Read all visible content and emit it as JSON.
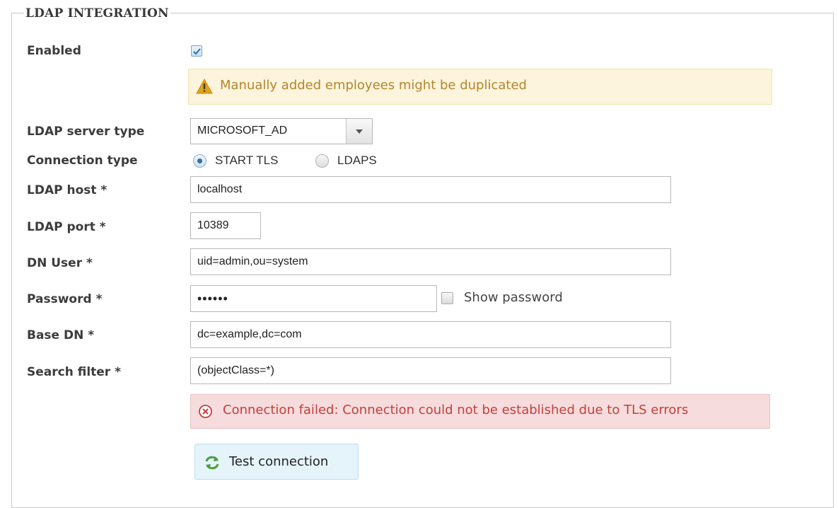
{
  "section": {
    "title": "LDAP INTEGRATION"
  },
  "fields": {
    "enabled_label": "Enabled",
    "enabled_checked": true,
    "server_type_label": "LDAP server type",
    "server_type_value": "MICROSOFT_AD",
    "connection_type_label": "Connection type",
    "connection_options": [
      {
        "label": "START TLS",
        "selected": true
      },
      {
        "label": "LDAPS",
        "selected": false
      }
    ],
    "host_label": "LDAP host *",
    "host_value": "localhost",
    "port_label": "LDAP port *",
    "port_value": "10389",
    "dn_user_label": "DN User *",
    "dn_user_value": "uid=admin,ou=system",
    "password_label": "Password *",
    "password_value": "••••••",
    "show_password_label": "Show password",
    "show_password_checked": false,
    "base_dn_label": "Base DN *",
    "base_dn_value": "dc=example,dc=com",
    "search_filter_label": "Search filter *",
    "search_filter_value": "(objectClass=*)"
  },
  "messages": {
    "warning": "Manually added employees might be duplicated",
    "error": "Connection failed: Connection could not be established due to TLS errors"
  },
  "actions": {
    "test_connection_label": "Test connection"
  },
  "icons": {
    "warning": "warning-triangle-icon",
    "error": "error-circle-x-icon",
    "refresh": "refresh-arrows-icon",
    "checkmark": "checkmark-icon",
    "dropdown": "chevron-down-icon"
  },
  "colors": {
    "warning_bg": "#fcf4dc",
    "warning_text": "#b4862f",
    "error_bg": "#f6dcdc",
    "error_text": "#c24040",
    "button_bg": "#e5f3fb",
    "refresh_icon": "#4a9e3c"
  }
}
